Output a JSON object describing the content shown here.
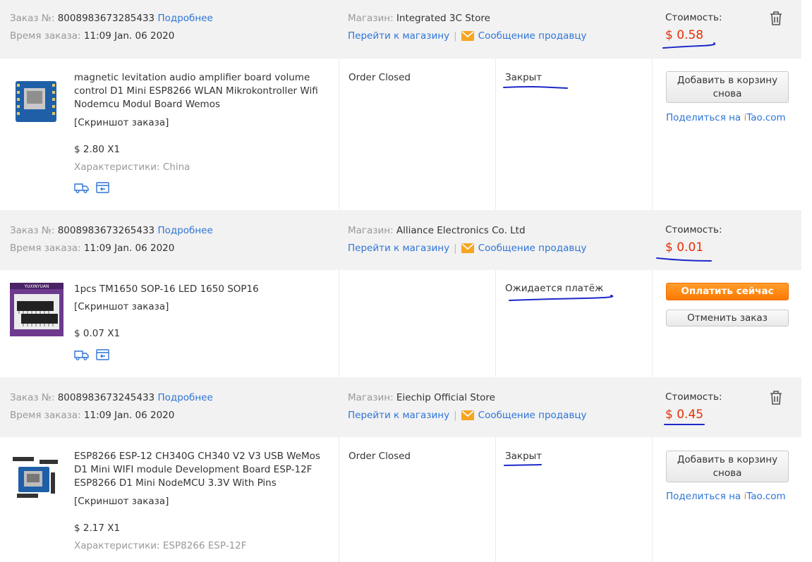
{
  "labels": {
    "order_no": "Заказ №:",
    "details": "Подробнее",
    "order_time": "Время заказа:",
    "store": "Магазин:",
    "go_store": "Перейти к магазину",
    "message_seller": "Сообщение продавцу",
    "cost": "Стоимость:",
    "snapshot": "[Скриншот заказа]",
    "specs": "Характеристики:",
    "share_prefix": "Поделиться на ",
    "share_i": "i",
    "share_tao": "Tao",
    "share_com": ".com"
  },
  "colors": {
    "accent": "#2e74d6",
    "price": "#e62e04",
    "pay_button": "#ff8200",
    "annotation": "#1c28c9"
  },
  "orders": [
    {
      "order_id": "8008983673285433",
      "time": "11:09 Jan. 06 2020",
      "store": "Integrated 3C Store",
      "cost": "$ 0.58",
      "product": {
        "title": "magnetic levitation audio amplifier board volume control D1 Mini ESP8266 WLAN Mikrokontroller Wifi Nodemcu Modul Board Wemos",
        "price_qty": "$ 2.80 X1",
        "specs": "China"
      },
      "order_status": "Order Closed",
      "status": "Закрыт",
      "actions": [
        "Добавить в корзину снова"
      ]
    },
    {
      "order_id": "8008983673265433",
      "time": "11:09 Jan. 06 2020",
      "store": "Alliance Electronics Co. Ltd",
      "cost": "$ 0.01",
      "product": {
        "title": "1pcs TM1650 SOP-16 LED 1650 SOP16",
        "price_qty": "$ 0.07 X1",
        "thumb_brand": "YUXINYUAN"
      },
      "order_status": "",
      "status": "Ожидается платёж",
      "actions": [
        "Оплатить сейчас",
        "Отменить заказ"
      ]
    },
    {
      "order_id": "8008983673245433",
      "time": "11:09 Jan. 06 2020",
      "store": "Eiechip Official Store",
      "cost": "$ 0.45",
      "product": {
        "title": "ESP8266 ESP-12 CH340G CH340 V2 V3 USB WeMos D1 Mini WIFI module Development Board ESP-12F ESP8266 D1 Mini NodeMCU 3.3V With Pins",
        "price_qty": "$ 2.17 X1",
        "specs": "ESP8266 ESP-12F"
      },
      "order_status": "Order Closed",
      "status": "Закрыт",
      "actions": [
        "Добавить в корзину снова"
      ]
    }
  ]
}
